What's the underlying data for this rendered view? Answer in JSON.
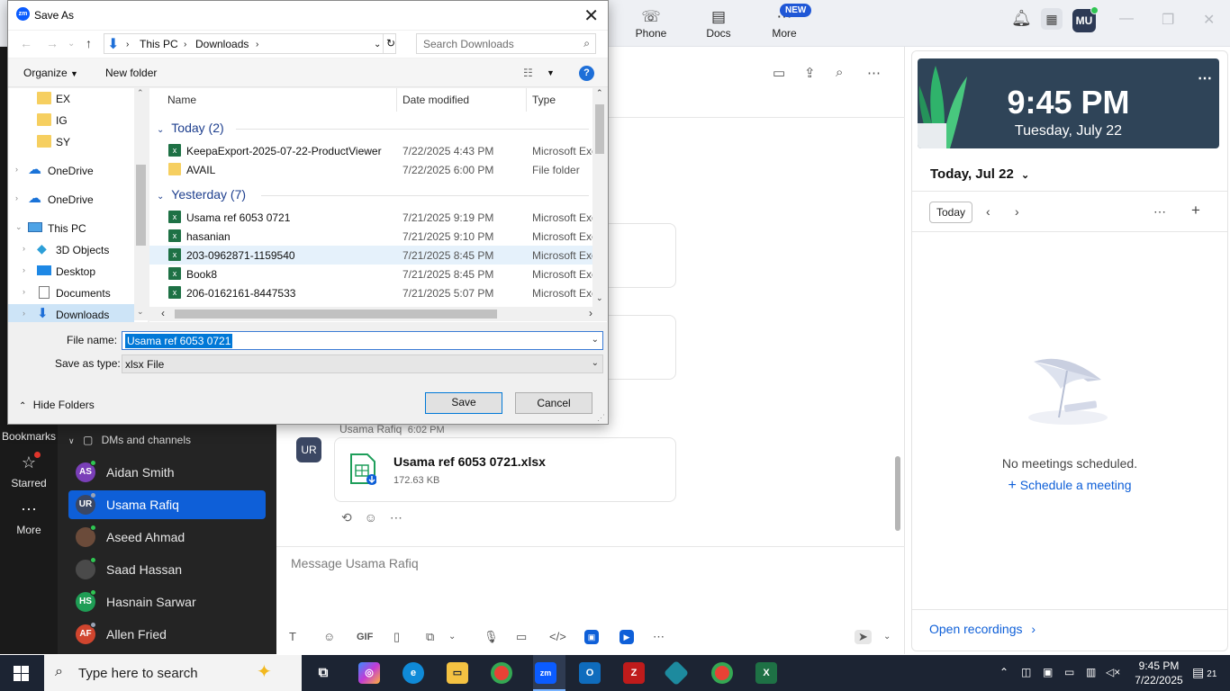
{
  "topbar": {
    "nav": [
      {
        "label": "Phone",
        "icon": "phone-icon"
      },
      {
        "label": "Docs",
        "icon": "docs-icon"
      },
      {
        "label": "More",
        "icon": "more-icon"
      }
    ],
    "new_badge": "NEW",
    "avatar_initials": "MU"
  },
  "left_nav": {
    "bookmarks_label": "Bookmarks",
    "starred_label": "Starred",
    "more_label": "More"
  },
  "chat_list": {
    "section_label": "DMs and channels",
    "contacts": [
      {
        "initials": "AS",
        "name": "Aidan Smith",
        "color": "#7a3fb8",
        "status": "#2fc552"
      },
      {
        "initials": "UR",
        "name": "Usama Rafiq",
        "color": "#3b4763",
        "status": "#9aa3b5"
      },
      {
        "initials": "",
        "name": "Aseed Ahmad",
        "color": "#6b4b3a",
        "status": "#2fc552"
      },
      {
        "initials": "",
        "name": "Saad Hassan",
        "color": "#4a4a4a",
        "status": "#2fc552"
      },
      {
        "initials": "HS",
        "name": "Hasnain Sarwar",
        "color": "#1f9d55",
        "status": "#2fc552"
      },
      {
        "initials": "AF",
        "name": "Allen Fried",
        "color": "#d0452e",
        "status": "#9aa3b5"
      }
    ]
  },
  "chat": {
    "msg_avatar": "UR",
    "msg_sender": "Usama Rafiq",
    "msg_time": "6:02 PM",
    "file_name": "Usama ref 6053 0721.xlsx",
    "file_size": "172.63 KB",
    "compose_placeholder": "Message Usama Rafiq",
    "gif_label": "GIF"
  },
  "calendar": {
    "time": "9:45 PM",
    "date": "Tuesday, July 22",
    "date_header": "Today, Jul 22",
    "today_button": "Today",
    "no_meetings": "No meetings scheduled.",
    "schedule_link": "Schedule a meeting",
    "open_recordings": "Open recordings"
  },
  "dialog": {
    "title": "Save As",
    "app_icon_text": "zm",
    "breadcrumb": [
      "This PC",
      "Downloads"
    ],
    "search_placeholder": "Search Downloads",
    "organize_label": "Organize",
    "new_folder_label": "New folder",
    "tree": [
      {
        "label": "EX",
        "type": "folder",
        "indent": 1
      },
      {
        "label": "IG",
        "type": "folder",
        "indent": 1
      },
      {
        "label": "SY",
        "type": "folder",
        "indent": 1
      },
      {
        "label": "OneDrive",
        "type": "cloud",
        "indent": 0
      },
      {
        "label": "OneDrive",
        "type": "cloud",
        "indent": 0
      },
      {
        "label": "This PC",
        "type": "pc",
        "indent": 0
      },
      {
        "label": "3D Objects",
        "type": "cube",
        "indent": 1
      },
      {
        "label": "Desktop",
        "type": "desktop",
        "indent": 1
      },
      {
        "label": "Documents",
        "type": "doc",
        "indent": 1
      },
      {
        "label": "Downloads",
        "type": "download",
        "indent": 1
      }
    ],
    "columns": {
      "name": "Name",
      "date": "Date modified",
      "type": "Type"
    },
    "groups": [
      {
        "label": "Today (2)",
        "files": [
          {
            "name": "KeepaExport-2025-07-22-ProductViewer",
            "date": "7/22/2025 4:43 PM",
            "type": "Microsoft Exc",
            "kind": "excel"
          },
          {
            "name": "AVAIL",
            "date": "7/22/2025 6:00 PM",
            "type": "File folder",
            "kind": "folder"
          }
        ]
      },
      {
        "label": "Yesterday (7)",
        "files": [
          {
            "name": "Usama ref 6053 0721",
            "date": "7/21/2025 9:19 PM",
            "type": "Microsoft Exc",
            "kind": "excel"
          },
          {
            "name": "hasanian",
            "date": "7/21/2025 9:10 PM",
            "type": "Microsoft Exc",
            "kind": "excel"
          },
          {
            "name": "203-0962871-1159540",
            "date": "7/21/2025 8:45 PM",
            "type": "Microsoft Exc",
            "kind": "excel"
          },
          {
            "name": "Book8",
            "date": "7/21/2025 8:45 PM",
            "type": "Microsoft Exc",
            "kind": "excel"
          },
          {
            "name": "206-0162161-8447533",
            "date": "7/21/2025 5:07 PM",
            "type": "Microsoft Exc",
            "kind": "excel"
          }
        ]
      }
    ],
    "file_name_label": "File name:",
    "file_name_value": "Usama ref 6053 0721",
    "save_type_label": "Save as type:",
    "save_type_value": "xlsx File",
    "hide_folders_label": "Hide Folders",
    "save_button": "Save",
    "cancel_button": "Cancel"
  },
  "taskbar": {
    "search_placeholder": "Type here to search",
    "clock_time": "9:45 PM",
    "clock_date": "7/22/2025",
    "notification_count": "21"
  }
}
